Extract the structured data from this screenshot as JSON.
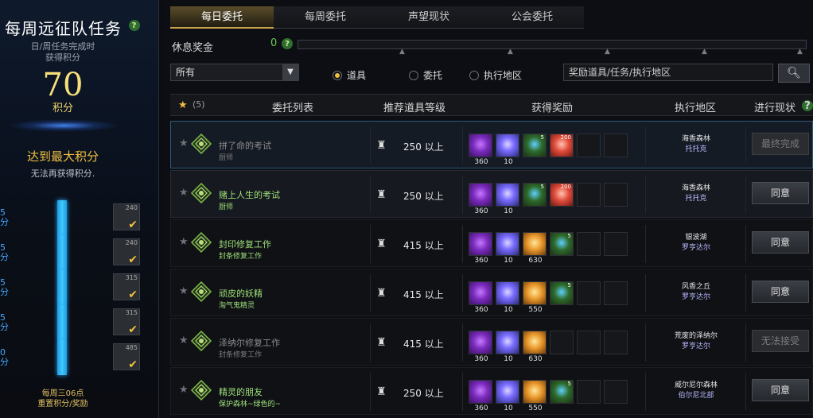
{
  "left": {
    "title": "每周远征队任务",
    "subtitle_1": "日/周任务完成时",
    "subtitle_2": "获得积分",
    "score": "70",
    "score_unit": "积分",
    "max_title": "达到最大积分",
    "max_sub": "无法再获得积分.",
    "tiers": [
      {
        "num": "5",
        "unit": "分",
        "reward": "240"
      },
      {
        "num": "5",
        "unit": "分",
        "reward": "240"
      },
      {
        "num": "5",
        "unit": "分",
        "reward": "315"
      },
      {
        "num": "5",
        "unit": "分",
        "reward": "315"
      },
      {
        "num": "0",
        "unit": "分",
        "reward": "485"
      }
    ],
    "reset_1": "每周三06点",
    "reset_2": "重置积分/奖励"
  },
  "tabs": [
    {
      "label": "每日委托",
      "active": true
    },
    {
      "label": "每周委托",
      "active": false
    },
    {
      "label": "声望现状",
      "active": false
    },
    {
      "label": "公会委托",
      "active": false
    }
  ],
  "rest": {
    "label": "休息奖金",
    "value": "0"
  },
  "filter": {
    "select": "所有",
    "radios": [
      "道具",
      "委托",
      "执行地区"
    ],
    "radio_selected": 0,
    "search_placeholder": "奖励道具/任务/执行地区"
  },
  "header": {
    "star_count": "(5)",
    "list": "委托列表",
    "level": "推荐道具等级",
    "reward": "获得奖励",
    "area": "执行地区",
    "status": "进行现状"
  },
  "rows": [
    {
      "starred": false,
      "title": "拼了命的考试",
      "sub": "厨师",
      "tone": "gray",
      "level": "250 以上",
      "rewards": [
        {
          "type": "purple",
          "num": "360",
          "sup": ""
        },
        {
          "type": "gem",
          "num": "10",
          "sup": ""
        },
        {
          "type": "green",
          "num": "",
          "sup": "5"
        },
        {
          "type": "heart",
          "num": "",
          "sup": "200"
        }
      ],
      "area": "海香森林",
      "area_sub": "托托克",
      "button": "最终完成",
      "button_enabled": false,
      "state": "sel"
    },
    {
      "starred": false,
      "title": "赌上人生的考试",
      "sub": "厨师",
      "tone": "green",
      "level": "250 以上",
      "rewards": [
        {
          "type": "purple",
          "num": "360",
          "sup": ""
        },
        {
          "type": "gem",
          "num": "10",
          "sup": ""
        },
        {
          "type": "green",
          "num": "",
          "sup": "5"
        },
        {
          "type": "heart",
          "num": "",
          "sup": "200"
        }
      ],
      "area": "海香森林",
      "area_sub": "托托克",
      "button": "同意",
      "button_enabled": true,
      "state": "hover"
    },
    {
      "starred": false,
      "title": "封印修复工作",
      "sub": "封条修复工作",
      "tone": "green",
      "level": "415 以上",
      "rewards": [
        {
          "type": "purple",
          "num": "360",
          "sup": ""
        },
        {
          "type": "gem",
          "num": "10",
          "sup": ""
        },
        {
          "type": "orange",
          "num": "630",
          "sup": ""
        },
        {
          "type": "green",
          "num": "",
          "sup": "5"
        }
      ],
      "area": "银波湖",
      "area_sub": "罗亨达尔",
      "button": "同意",
      "button_enabled": true,
      "state": ""
    },
    {
      "starred": false,
      "title": "顽皮的妖精",
      "sub": "淘气鬼精灵",
      "tone": "green",
      "level": "415 以上",
      "rewards": [
        {
          "type": "purple",
          "num": "360",
          "sup": ""
        },
        {
          "type": "gem",
          "num": "10",
          "sup": ""
        },
        {
          "type": "orange",
          "num": "550",
          "sup": ""
        },
        {
          "type": "green",
          "num": "",
          "sup": "5"
        }
      ],
      "area": "风香之丘",
      "area_sub": "罗亨达尔",
      "button": "同意",
      "button_enabled": true,
      "state": ""
    },
    {
      "starred": false,
      "title": "泽纳尔修复工作",
      "sub": "封条修复工作",
      "tone": "gray",
      "level": "415 以上",
      "rewards": [
        {
          "type": "purple",
          "num": "360",
          "sup": ""
        },
        {
          "type": "gem",
          "num": "10",
          "sup": ""
        },
        {
          "type": "orange",
          "num": "630",
          "sup": ""
        }
      ],
      "area": "荒废的泽纳尔",
      "area_sub": "罗亨达尔",
      "button": "无法接受",
      "button_enabled": false,
      "state": ""
    },
    {
      "starred": false,
      "title": "精灵的朋友",
      "sub": "保护森林~绿色的~",
      "tone": "green",
      "level": "250 以上",
      "rewards": [
        {
          "type": "purple",
          "num": "360",
          "sup": ""
        },
        {
          "type": "gem",
          "num": "10",
          "sup": ""
        },
        {
          "type": "orange",
          "num": "550",
          "sup": ""
        },
        {
          "type": "green",
          "num": "",
          "sup": "5"
        }
      ],
      "area": "威尔尼尔森林",
      "area_sub": "伯尔尼北部",
      "button": "同意",
      "button_enabled": true,
      "state": ""
    }
  ]
}
